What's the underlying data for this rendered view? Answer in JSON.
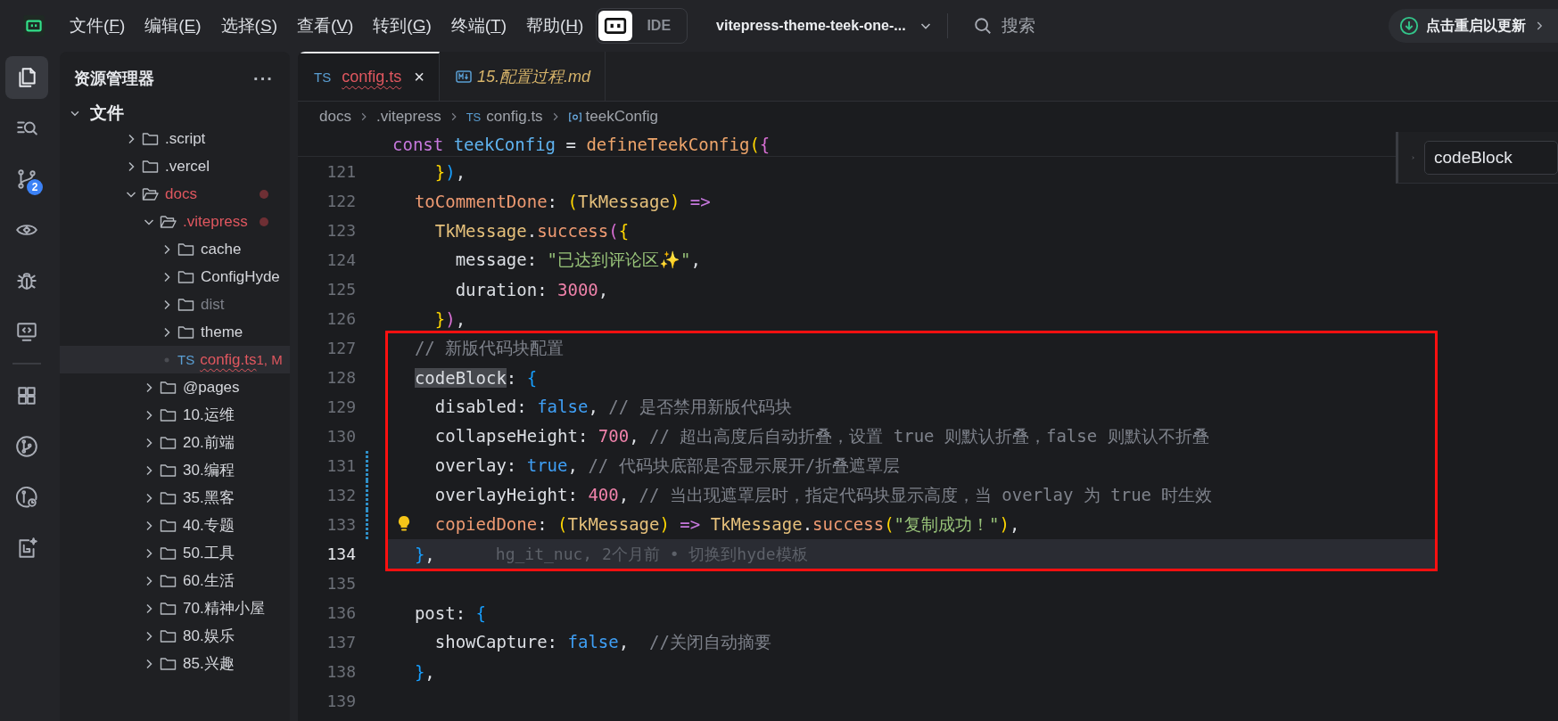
{
  "top_bar": {
    "menu": [
      {
        "before": "文件(",
        "key": "F",
        "after": ")"
      },
      {
        "before": "编辑(",
        "key": "E",
        "after": ")"
      },
      {
        "before": "选择(",
        "key": "S",
        "after": ")"
      },
      {
        "before": "查看(",
        "key": "V",
        "after": ")"
      },
      {
        "before": "转到(",
        "key": "G",
        "after": ")"
      },
      {
        "before": "终端(",
        "key": "T",
        "after": ")"
      },
      {
        "before": "帮助(",
        "key": "H",
        "after": ")"
      }
    ],
    "mode_toggle": [
      {
        "kind": "icon",
        "selected": true
      },
      {
        "kind": "text",
        "label": "IDE",
        "selected": false
      }
    ],
    "project": {
      "name": "vitepress-theme-teek-one-..."
    },
    "search": {
      "label": "搜索"
    },
    "update_button": {
      "label": "点击重启以更新"
    }
  },
  "activity_bar": {
    "top": [
      {
        "kind": "files",
        "selected": true
      },
      {
        "kind": "search",
        "selected": false
      },
      {
        "kind": "source-control",
        "selected": false,
        "badge": "2"
      },
      {
        "kind": "preview",
        "selected": false
      },
      {
        "kind": "debug",
        "selected": false
      },
      {
        "kind": "remote",
        "selected": false
      }
    ],
    "bottom": [
      {
        "kind": "extensions",
        "selected": false
      },
      {
        "kind": "git-graph",
        "selected": false
      },
      {
        "kind": "git-history",
        "selected": false
      },
      {
        "kind": "ai",
        "selected": false
      }
    ]
  },
  "sidebar": {
    "title": "资源管理器",
    "more": "···",
    "section": "文件",
    "tree": [
      {
        "label": ".script",
        "kind": "folder",
        "expanded": false,
        "selected": false,
        "modified": false,
        "ignored": false
      },
      {
        "label": ".vercel",
        "kind": "folder",
        "expanded": false,
        "selected": false,
        "modified": false,
        "ignored": false
      },
      {
        "label": "docs",
        "kind": "folder",
        "expanded": true,
        "selected": false,
        "modified": true,
        "ignored": false,
        "children": [
          {
            "label": ".vitepress",
            "kind": "folder",
            "expanded": true,
            "selected": false,
            "modified": true,
            "ignored": false,
            "children": [
              {
                "label": "cache",
                "kind": "folder",
                "expanded": false,
                "selected": false,
                "modified": false,
                "ignored": false
              },
              {
                "label": "ConfigHyde",
                "kind": "folder",
                "expanded": false,
                "selected": false,
                "modified": false,
                "ignored": false
              },
              {
                "label": "dist",
                "kind": "folder",
                "expanded": false,
                "selected": false,
                "modified": false,
                "ignored": true
              },
              {
                "label": "theme",
                "kind": "folder",
                "expanded": false,
                "selected": false,
                "modified": false,
                "ignored": false
              },
              {
                "label": "config.ts",
                "kind": "file",
                "icon_text": "TS",
                "selected": true,
                "modified": true,
                "ignored": false,
                "error": true,
                "badge": "1, M"
              }
            ]
          },
          {
            "label": "@pages",
            "kind": "folder",
            "expanded": false,
            "selected": false,
            "modified": false,
            "ignored": false
          },
          {
            "label": "10.运维",
            "kind": "folder",
            "expanded": false,
            "selected": false,
            "modified": false,
            "ignored": false
          },
          {
            "label": "20.前端",
            "kind": "folder",
            "expanded": false,
            "selected": false,
            "modified": false,
            "ignored": false
          },
          {
            "label": "30.编程",
            "kind": "folder",
            "expanded": false,
            "selected": false,
            "modified": false,
            "ignored": false
          },
          {
            "label": "35.黑客",
            "kind": "folder",
            "expanded": false,
            "selected": false,
            "modified": false,
            "ignored": false
          },
          {
            "label": "40.专题",
            "kind": "folder",
            "expanded": false,
            "selected": false,
            "modified": false,
            "ignored": false
          },
          {
            "label": "50.工具",
            "kind": "folder",
            "expanded": false,
            "selected": false,
            "modified": false,
            "ignored": false
          },
          {
            "label": "60.生活",
            "kind": "folder",
            "expanded": false,
            "selected": false,
            "modified": false,
            "ignored": false
          },
          {
            "label": "70.精神小屋",
            "kind": "folder",
            "expanded": false,
            "selected": false,
            "modified": false,
            "ignored": false
          },
          {
            "label": "80.娱乐",
            "kind": "folder",
            "expanded": false,
            "selected": false,
            "modified": false,
            "ignored": false
          },
          {
            "label": "85.兴趣",
            "kind": "folder",
            "expanded": false,
            "selected": false,
            "modified": false,
            "ignored": false
          }
        ]
      }
    ]
  },
  "editor": {
    "tabs": [
      {
        "label": "config.ts",
        "kind": "ts",
        "icon_text": "TS",
        "selected": true,
        "preview": false,
        "error": true,
        "close": "×"
      },
      {
        "label": "15.配置过程.md",
        "kind": "md",
        "selected": false,
        "preview": true,
        "error": false
      }
    ],
    "breadcrumb": [
      {
        "label": "docs",
        "kind": "folder"
      },
      {
        "label": ".vitepress",
        "kind": "folder"
      },
      {
        "label": "config.ts",
        "kind": "ts",
        "icon_text": "TS"
      },
      {
        "label": "teekConfig",
        "kind": "symbol"
      }
    ],
    "sticky_header": [
      {
        "text": "const",
        "kind": "kw"
      },
      {
        "text": " teekConfig",
        "kind": "var"
      },
      {
        "text": " = ",
        "kind": "plain"
      },
      {
        "text": "defineTeekConfig",
        "kind": "func"
      },
      {
        "text": "(",
        "kind": "by"
      },
      {
        "text": "{",
        "kind": "bp"
      }
    ],
    "find": {
      "value": "codeBlock"
    },
    "code_blocks": [
      {
        "kind": "plain",
        "lines": [
          {
            "number": "121",
            "current": false,
            "git_modified": false,
            "lightbulb": false,
            "tokens": [
              {
                "text": "    }",
                "kind": "by"
              },
              {
                "text": ")",
                "kind": "bb"
              },
              {
                "text": ",",
                "kind": "plain"
              }
            ]
          },
          {
            "number": "122",
            "current": false,
            "git_modified": false,
            "lightbulb": false,
            "tokens": [
              {
                "text": "  toCommentDone",
                "kind": "method"
              },
              {
                "text": ": ",
                "kind": "plain"
              },
              {
                "text": "(",
                "kind": "by"
              },
              {
                "text": "TkMessage",
                "kind": "type"
              },
              {
                "text": ")",
                "kind": "by"
              },
              {
                "text": " =>",
                "kind": "op"
              }
            ]
          },
          {
            "number": "123",
            "current": false,
            "git_modified": false,
            "lightbulb": false,
            "tokens": [
              {
                "text": "    TkMessage",
                "kind": "type"
              },
              {
                "text": ".",
                "kind": "plain"
              },
              {
                "text": "success",
                "kind": "method"
              },
              {
                "text": "(",
                "kind": "bp"
              },
              {
                "text": "{",
                "kind": "by"
              }
            ]
          },
          {
            "number": "124",
            "current": false,
            "git_modified": false,
            "lightbulb": false,
            "tokens": [
              {
                "text": "      message",
                "kind": "prop"
              },
              {
                "text": ": ",
                "kind": "plain"
              },
              {
                "text": "\"已达到评论区✨\"",
                "kind": "str"
              },
              {
                "text": ",",
                "kind": "plain"
              }
            ]
          },
          {
            "number": "125",
            "current": false,
            "git_modified": false,
            "lightbulb": false,
            "tokens": [
              {
                "text": "      duration",
                "kind": "prop"
              },
              {
                "text": ": ",
                "kind": "plain"
              },
              {
                "text": "3000",
                "kind": "num"
              },
              {
                "text": ",",
                "kind": "plain"
              }
            ]
          },
          {
            "number": "126",
            "current": false,
            "git_modified": false,
            "lightbulb": false,
            "tokens": [
              {
                "text": "    }",
                "kind": "by"
              },
              {
                "text": ")",
                "kind": "bp"
              },
              {
                "text": ",",
                "kind": "plain"
              }
            ]
          }
        ]
      },
      {
        "kind": "framed",
        "lines": [
          {
            "number": "127",
            "current": false,
            "git_modified": false,
            "lightbulb": false,
            "tokens": [
              {
                "text": "  // 新版代码块配置",
                "kind": "comment"
              }
            ]
          },
          {
            "number": "128",
            "current": false,
            "git_modified": false,
            "lightbulb": false,
            "tokens": [
              {
                "text": "  codeBlock",
                "kind": "match"
              },
              {
                "text": ": ",
                "kind": "plain"
              },
              {
                "text": "{",
                "kind": "bb"
              }
            ]
          },
          {
            "number": "129",
            "current": false,
            "git_modified": false,
            "lightbulb": false,
            "tokens": [
              {
                "text": "    disabled",
                "kind": "prop"
              },
              {
                "text": ": ",
                "kind": "plain"
              },
              {
                "text": "false",
                "kind": "bool"
              },
              {
                "text": ", ",
                "kind": "plain"
              },
              {
                "text": "// 是否禁用新版代码块",
                "kind": "comment"
              }
            ]
          },
          {
            "number": "130",
            "current": false,
            "git_modified": false,
            "lightbulb": false,
            "tokens": [
              {
                "text": "    collapseHeight",
                "kind": "prop"
              },
              {
                "text": ": ",
                "kind": "plain"
              },
              {
                "text": "700",
                "kind": "num"
              },
              {
                "text": ", ",
                "kind": "plain"
              },
              {
                "text": "// 超出高度后自动折叠，设置 true 则默认折叠，false 则默认不折叠",
                "kind": "comment"
              }
            ]
          },
          {
            "number": "131",
            "current": false,
            "git_modified": true,
            "lightbulb": false,
            "tokens": [
              {
                "text": "    overlay",
                "kind": "prop"
              },
              {
                "text": ": ",
                "kind": "plain"
              },
              {
                "text": "true",
                "kind": "bool"
              },
              {
                "text": ", ",
                "kind": "plain"
              },
              {
                "text": "// 代码块底部是否显示展开/折叠遮罩层",
                "kind": "comment"
              }
            ]
          },
          {
            "number": "132",
            "current": false,
            "git_modified": true,
            "lightbulb": false,
            "tokens": [
              {
                "text": "    overlayHeight",
                "kind": "prop"
              },
              {
                "text": ": ",
                "kind": "plain"
              },
              {
                "text": "400",
                "kind": "num"
              },
              {
                "text": ", ",
                "kind": "plain"
              },
              {
                "text": "// 当出现遮罩层时，指定代码块显示高度，当 overlay 为 true 时生效",
                "kind": "comment"
              }
            ]
          },
          {
            "number": "133",
            "current": false,
            "git_modified": true,
            "lightbulb": true,
            "tokens": [
              {
                "text": "    copiedDone",
                "kind": "method"
              },
              {
                "text": ": ",
                "kind": "plain"
              },
              {
                "text": "(",
                "kind": "by"
              },
              {
                "text": "TkMessage",
                "kind": "type"
              },
              {
                "text": ")",
                "kind": "by"
              },
              {
                "text": " => ",
                "kind": "op"
              },
              {
                "text": "TkMessage",
                "kind": "type"
              },
              {
                "text": ".",
                "kind": "plain"
              },
              {
                "text": "success",
                "kind": "method"
              },
              {
                "text": "(",
                "kind": "by"
              },
              {
                "text": "\"复制成功！\"",
                "kind": "str"
              },
              {
                "text": ")",
                "kind": "by"
              },
              {
                "text": ",",
                "kind": "plain"
              }
            ]
          },
          {
            "number": "134",
            "current": true,
            "git_modified": false,
            "lightbulb": false,
            "blame": "hg_it_nuc, 2个月前 • 切换到hyde模板",
            "tokens": [
              {
                "text": "  }",
                "kind": "bb"
              },
              {
                "text": ",",
                "kind": "plain"
              }
            ]
          }
        ]
      },
      {
        "kind": "plain",
        "lines": [
          {
            "number": "135",
            "current": false,
            "git_modified": false,
            "lightbulb": false
          },
          {
            "number": "136",
            "current": false,
            "git_modified": false,
            "lightbulb": false,
            "tokens": [
              {
                "text": "  post",
                "kind": "prop"
              },
              {
                "text": ": ",
                "kind": "plain"
              },
              {
                "text": "{",
                "kind": "bb"
              }
            ]
          },
          {
            "number": "137",
            "current": false,
            "git_modified": false,
            "lightbulb": false,
            "tokens": [
              {
                "text": "    showCapture",
                "kind": "prop"
              },
              {
                "text": ": ",
                "kind": "plain"
              },
              {
                "text": "false",
                "kind": "bool"
              },
              {
                "text": ",  ",
                "kind": "plain"
              },
              {
                "text": "//关闭自动摘要",
                "kind": "comment"
              }
            ]
          },
          {
            "number": "138",
            "current": false,
            "git_modified": false,
            "lightbulb": false,
            "tokens": [
              {
                "text": "  }",
                "kind": "bb"
              },
              {
                "text": ",",
                "kind": "plain"
              }
            ]
          },
          {
            "number": "139",
            "current": false,
            "git_modified": false,
            "lightbulb": false
          }
        ]
      }
    ]
  }
}
